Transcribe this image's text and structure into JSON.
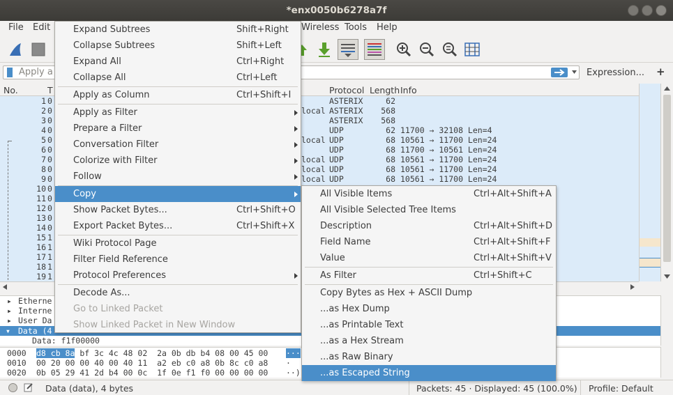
{
  "window": {
    "title": "*enx0050b6278a7f"
  },
  "menubar": {
    "file": "File",
    "edit": "Edit",
    "wireless": "Wireless",
    "tools": "Tools",
    "help": "Help"
  },
  "filter": {
    "placeholder": "Apply a",
    "expression": "Expression...",
    "plus": "+"
  },
  "columns": {
    "no": "No.",
    "time": "T",
    "protocol": "Protocol",
    "length": "Length",
    "info": "Info"
  },
  "rows": [
    {
      "no": "1",
      "t": "0",
      "src": "",
      "proto": "ASTERIX",
      "len": "62",
      "info": ""
    },
    {
      "no": "2",
      "t": "0",
      "src": "local",
      "proto": "ASTERIX",
      "len": "568",
      "info": ""
    },
    {
      "no": "3",
      "t": "0",
      "src": "",
      "proto": "ASTERIX",
      "len": "568",
      "info": ""
    },
    {
      "no": "4",
      "t": "0",
      "src": "",
      "proto": "UDP",
      "len": "62",
      "info": "11700 → 32108 Len=4"
    },
    {
      "no": "5",
      "t": "0",
      "src": "local",
      "proto": "UDP",
      "len": "68",
      "info": "10561 → 11700 Len=24"
    },
    {
      "no": "6",
      "t": "0",
      "src": "",
      "proto": "UDP",
      "len": "68",
      "info": "11700 → 10561 Len=24"
    },
    {
      "no": "7",
      "t": "0",
      "src": "local",
      "proto": "UDP",
      "len": "68",
      "info": "10561 → 11700 Len=24"
    },
    {
      "no": "8",
      "t": "0",
      "src": "local",
      "proto": "UDP",
      "len": "68",
      "info": "10561 → 11700 Len=24"
    },
    {
      "no": "9",
      "t": "0",
      "src": "local",
      "proto": "UDP",
      "len": "68",
      "info": "10561 → 11700 Len=24"
    },
    {
      "no": "10",
      "t": "0"
    },
    {
      "no": "11",
      "t": "0"
    },
    {
      "no": "12",
      "t": "0"
    },
    {
      "no": "13",
      "t": "0"
    },
    {
      "no": "14",
      "t": "0"
    },
    {
      "no": "15",
      "t": "1"
    },
    {
      "no": "16",
      "t": "1"
    },
    {
      "no": "17",
      "t": "1"
    },
    {
      "no": "18",
      "t": "1"
    },
    {
      "no": "19",
      "t": "1"
    }
  ],
  "detail": {
    "eth": "Etherne",
    "ip": "Interne",
    "udp": "User Da",
    "data": "Data (4",
    "data_line": "Data: f1f00000"
  },
  "bytes": [
    {
      "off": "0000",
      "sel": "d8 cb 8a",
      "hex": " bf 3c 4c 48 02  2a 0b db b4 08 00 45 00",
      "ascii": "···"
    },
    {
      "off": "0010",
      "sel": "",
      "hex": "00 20 00 00 40 00 40 11  a2 eb c0 a8 0b 8c c0 a8",
      "ascii": "·"
    },
    {
      "off": "0020",
      "sel": "",
      "hex": "0b 05 29 41 2d b4 00 0c  1f 0e f1 f0 00 00 00 00",
      "ascii": "··)"
    }
  ],
  "status": {
    "field": "Data (data), 4 bytes",
    "packets": "Packets: 45 · Displayed: 45 (100.0%)",
    "profile": "Profile: Default"
  },
  "context_menu": [
    {
      "label": "Expand Subtrees",
      "shortcut": "Shift+Right"
    },
    {
      "label": "Collapse Subtrees",
      "shortcut": "Shift+Left"
    },
    {
      "label": "Expand All",
      "shortcut": "Ctrl+Right"
    },
    {
      "label": "Collapse All",
      "shortcut": "Ctrl+Left"
    },
    {
      "label": "Apply as Column",
      "shortcut": "Ctrl+Shift+I"
    },
    {
      "label": "Apply as Filter",
      "shortcut": ""
    },
    {
      "label": "Prepare a Filter",
      "shortcut": ""
    },
    {
      "label": "Conversation Filter",
      "shortcut": ""
    },
    {
      "label": "Colorize with Filter",
      "shortcut": ""
    },
    {
      "label": "Follow",
      "shortcut": ""
    },
    {
      "label": "Copy",
      "shortcut": ""
    },
    {
      "label": "Show Packet Bytes...",
      "shortcut": "Ctrl+Shift+O"
    },
    {
      "label": "Export Packet Bytes...",
      "shortcut": "Ctrl+Shift+X"
    },
    {
      "label": "Wiki Protocol Page",
      "shortcut": ""
    },
    {
      "label": "Filter Field Reference",
      "shortcut": ""
    },
    {
      "label": "Protocol Preferences",
      "shortcut": ""
    },
    {
      "label": "Decode As...",
      "shortcut": ""
    },
    {
      "label": "Go to Linked Packet",
      "shortcut": ""
    },
    {
      "label": "Show Linked Packet in New Window",
      "shortcut": ""
    }
  ],
  "copy_submenu": [
    {
      "label": "All Visible Items",
      "shortcut": "Ctrl+Alt+Shift+A"
    },
    {
      "label": "All Visible Selected Tree Items",
      "shortcut": ""
    },
    {
      "label": "Description",
      "shortcut": "Ctrl+Alt+Shift+D"
    },
    {
      "label": "Field Name",
      "shortcut": "Ctrl+Alt+Shift+F"
    },
    {
      "label": "Value",
      "shortcut": "Ctrl+Alt+Shift+V"
    },
    {
      "label": "As Filter",
      "shortcut": "Ctrl+Shift+C"
    },
    {
      "label": "Copy Bytes as Hex + ASCII Dump",
      "shortcut": ""
    },
    {
      "label": "...as Hex Dump",
      "shortcut": ""
    },
    {
      "label": "...as Printable Text",
      "shortcut": ""
    },
    {
      "label": "...as a Hex Stream",
      "shortcut": ""
    },
    {
      "label": "...as Raw Binary",
      "shortcut": ""
    },
    {
      "label": "...as Escaped String",
      "shortcut": ""
    }
  ],
  "colors": {
    "highlight": "#4a8ec9",
    "list_bg": "#dcebf9",
    "data_row": "#4a8ec9"
  }
}
